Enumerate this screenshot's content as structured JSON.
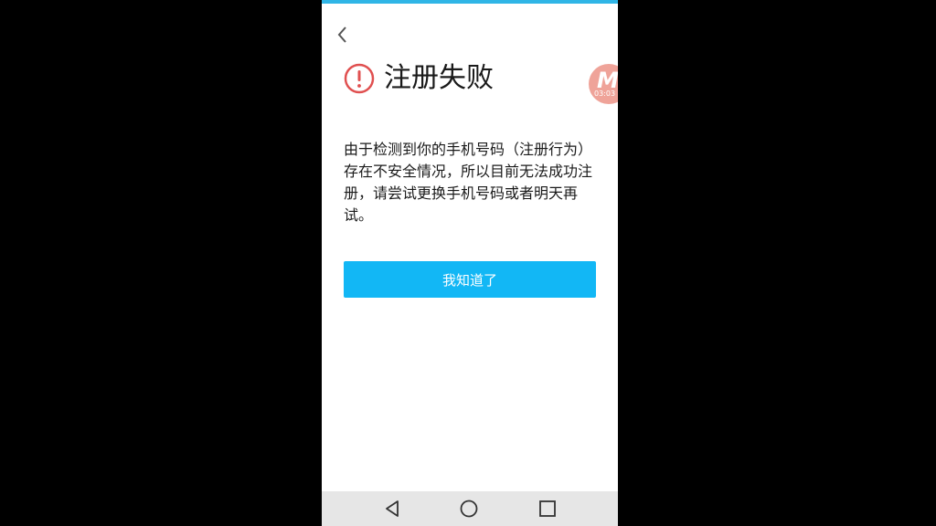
{
  "header": {
    "title": "注册失败"
  },
  "recorder_badge": {
    "letter": "M",
    "time": "03:03"
  },
  "dialog": {
    "message": "由于检测到你的手机号码（注册行为）存在不安全情况，所以目前无法成功注册，请尝试更换手机号码或者明天再试。",
    "ok_label": "我知道了"
  },
  "icons": {
    "back": "chevron-left-icon",
    "alert": "exclamation-circle-icon",
    "nav_back": "triangle-back-icon",
    "nav_home": "circle-home-icon",
    "nav_recents": "square-recents-icon"
  },
  "colors": {
    "accent": "#12b7f5",
    "alert": "#e05050",
    "top_strip": "#2fb5e6",
    "nav_bar": "#e6e6e6"
  }
}
